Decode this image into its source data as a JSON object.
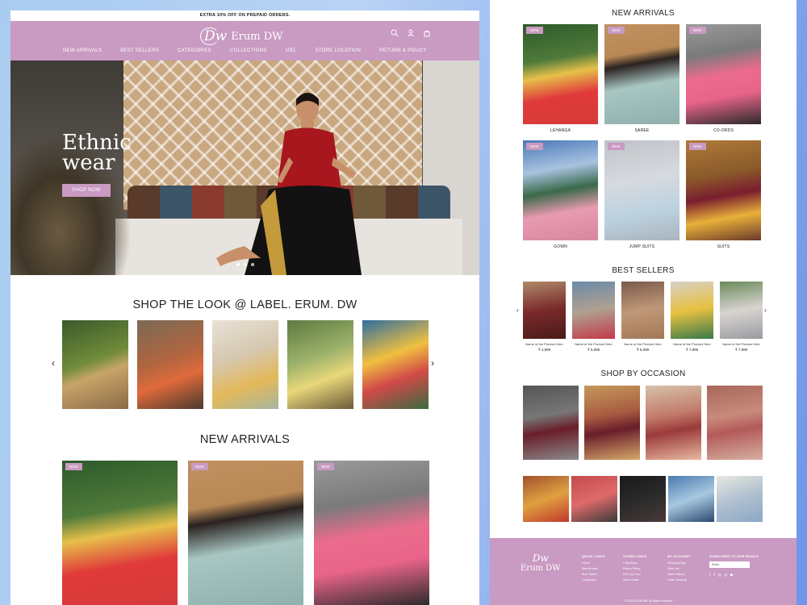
{
  "promo": "EXTRA 10% OFF ON PREPAID ORDERS.",
  "brand": {
    "mark": "Dw",
    "name": "Erum DW"
  },
  "nav": [
    "NEW ARRIVALS",
    "BEST SELLERS",
    "CATEGORIES",
    "COLLECTIONS",
    "IZEL",
    "STORE LOCATION",
    "RETURN & POLICY"
  ],
  "header_icons": [
    "search-icon",
    "user-icon",
    "cart-icon"
  ],
  "hero": {
    "title_line1": "Ethnic",
    "title_line2": "wear",
    "button": "SHOP NOW"
  },
  "shop_the_look": {
    "title": "SHOP THE LOOK @ LABEL. ERUM. DW"
  },
  "new_arrivals": {
    "title": "NEW ARRIVALS",
    "badge": "NEW",
    "items": [
      {
        "label": "LEHANGA"
      },
      {
        "label": "SAREE"
      },
      {
        "label": "CO-ORDS"
      },
      {
        "label": "GOWN"
      },
      {
        "label": "JUMP SUITS"
      },
      {
        "label": "SUITS"
      }
    ]
  },
  "best_sellers": {
    "title": "BEST SELLERS",
    "items": [
      {
        "name": "Name of the Product Here",
        "price": "₹ 4,999"
      },
      {
        "name": "Name of the Product Here",
        "price": "₹ 5,999"
      },
      {
        "name": "Name of the Product Here",
        "price": "₹ 6,999"
      },
      {
        "name": "Name of the Product Here",
        "price": "₹ 7,999"
      },
      {
        "name": "Name of the Product Here",
        "price": "₹ 7,999"
      }
    ]
  },
  "shop_by_occasion": {
    "title": "SHOP BY OCCASION"
  },
  "footer": {
    "quick_links": {
      "heading": "QUICK LINKS",
      "items": [
        "Home",
        "New Arrivals",
        "Best Sellers",
        "Categories"
      ]
    },
    "other_links": {
      "heading": "OTHER LINKS",
      "items": [
        "Collections",
        "Return Policy",
        "IZEL by Erum",
        "Store Finder"
      ]
    },
    "my_account": {
      "heading": "MY ACCOUNT",
      "items": [
        "Shopping Bag",
        "Wish List",
        "Order History",
        "Order Tracking"
      ]
    },
    "newsletter": {
      "heading": "SUBSCRIBE TO OUR EMAILS",
      "placeholder": "Email"
    },
    "social": [
      "twitter-icon",
      "facebook-icon",
      "instagram-icon",
      "pinterest-icon",
      "youtube-icon"
    ],
    "copyright": "© 2023 ERUM DW. All Rights reserved"
  },
  "colors": {
    "brand": "#c99ac2",
    "text": "#222222"
  }
}
